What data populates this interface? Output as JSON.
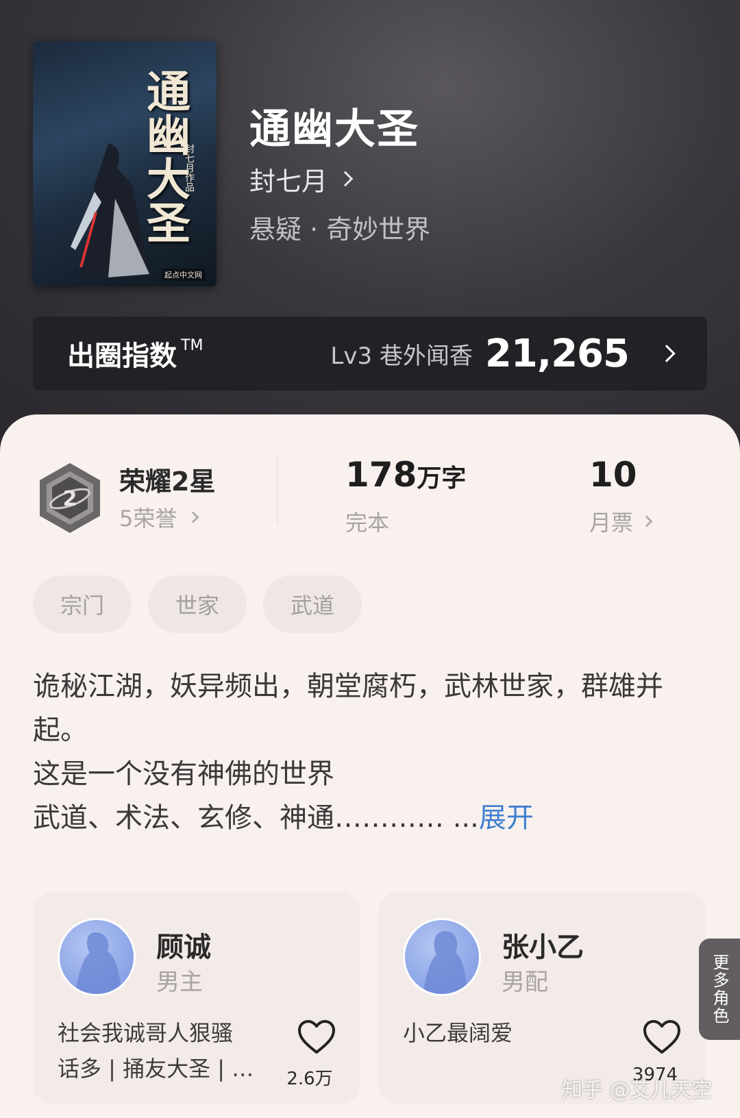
{
  "book": {
    "title": "通幽大圣",
    "author": "封七月",
    "genre": "悬疑 · 奇妙世界",
    "cover": {
      "title": "通幽大圣",
      "byline": "封七月作品",
      "publisher": "起点中文网"
    }
  },
  "index": {
    "label": "出圈指数",
    "tm": "TM",
    "level": "Lv3 巷外闻香",
    "score": "21,265"
  },
  "stats": {
    "honor_title": "荣耀2星",
    "honor_sub": "5荣誉",
    "badge_number": "2",
    "words_num": "178",
    "words_unit": "万字",
    "status": "完本",
    "tickets": "10",
    "tickets_label": "月票"
  },
  "tags": [
    "宗门",
    "世家",
    "武道"
  ],
  "description": {
    "line1": "诡秘江湖，妖异频出，朝堂腐朽，武林世家，群雄并起。",
    "line2": "这是一个没有神佛的世界",
    "line3": "武道、术法、玄修、神通………… ...",
    "expand": "展开"
  },
  "roles": [
    {
      "name": "顾诚",
      "type": "男主",
      "desc_line1": "社会我诚哥人狠骚",
      "desc_line2": "话多 | 捅友大圣 | …",
      "likes": "2.6万"
    },
    {
      "name": "张小乙",
      "type": "男配",
      "desc_line1": "",
      "desc_line2": "小乙最阔爱",
      "likes": "3974"
    }
  ],
  "more_roles": "更多角色",
  "watermark": "知乎 @艾儿天空",
  "colors": {
    "card_bg": "#f8f1ee",
    "link_blue": "#3f7fd0",
    "avatar_blue": "#8aa3e6"
  }
}
